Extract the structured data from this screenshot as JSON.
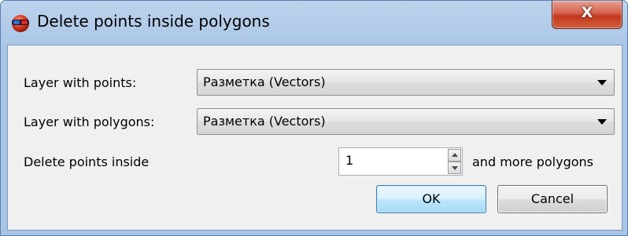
{
  "window": {
    "title": "Delete points inside polygons",
    "close_label": "X",
    "app_icon": "red-sphere-3d-glasses-icon"
  },
  "form": {
    "points_layer": {
      "label": "Layer with points:",
      "value": "Разметка (Vectors)"
    },
    "polygons_layer": {
      "label": "Layer with polygons:",
      "value": "Разметка (Vectors)"
    },
    "delete_inside": {
      "label": "Delete points inside",
      "value": "1",
      "suffix": "and more polygons"
    }
  },
  "buttons": {
    "ok": "OK",
    "cancel": "Cancel"
  },
  "colors": {
    "titlebar": "#aac6e6",
    "close_button": "#c2381f",
    "dialog_background": "#f0f0f0",
    "default_button_border": "#3c7fb1"
  }
}
